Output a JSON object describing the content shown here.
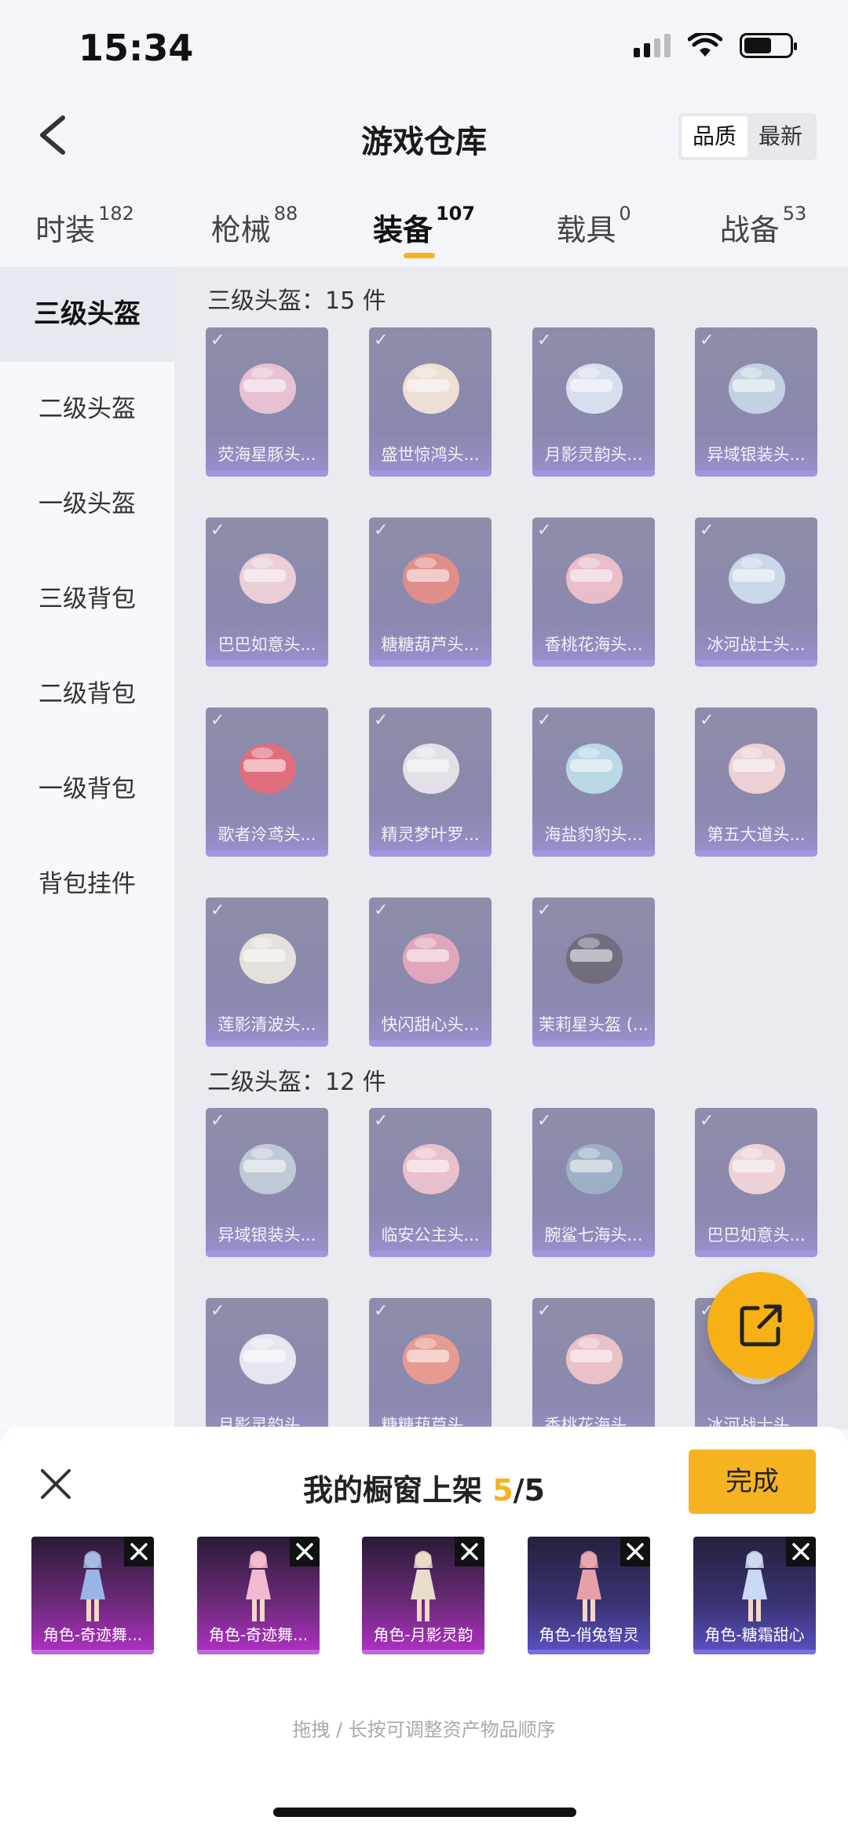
{
  "status": {
    "time": "15:34"
  },
  "header": {
    "title": "游戏仓库",
    "sort_options": [
      "品质",
      "最新"
    ]
  },
  "tabs": [
    {
      "label": "时装",
      "count": "182"
    },
    {
      "label": "枪械",
      "count": "88"
    },
    {
      "label": "装备",
      "count": "107"
    },
    {
      "label": "载具",
      "count": "0"
    },
    {
      "label": "战备",
      "count": "53"
    }
  ],
  "sidebar": [
    "三级头盔",
    "二级头盔",
    "一级头盔",
    "三级背包",
    "二级背包",
    "一级背包",
    "背包挂件"
  ],
  "sections": [
    {
      "title": "三级头盔：15 件",
      "items": [
        "荧海星豚头...",
        "盛世惊鸿头...",
        "月影灵韵头...",
        "异域银装头...",
        "巴巴如意头...",
        "糖糖葫芦头...",
        "香桃花海头...",
        "冰河战士头...",
        "歌者泠鸢头...",
        "精灵梦叶罗...",
        "海盐豹豹头...",
        "第五大道头...",
        "莲影清波头...",
        "快闪甜心头...",
        "茉莉星头盔 (..."
      ]
    },
    {
      "title": "二级头盔：12 件",
      "items": [
        "异域银装头...",
        "临安公主头...",
        "腕鲨七海头...",
        "巴巴如意头...",
        "月影灵韵头...",
        "糖糖葫芦头...",
        "香桃花海头...",
        "冰河战士头..."
      ]
    }
  ],
  "panel": {
    "title_prefix": "我的橱窗上架 ",
    "count_current": "5",
    "count_total": "/5",
    "done_label": "完成",
    "hint": "拖拽 / 长按可调整资产物品顺序",
    "items": [
      "角色-奇迹舞...",
      "角色-奇迹舞...",
      "角色-月影灵韵",
      "角色-俏兔智灵",
      "角色-糖霜甜心"
    ]
  },
  "colors": {
    "accent": "#f5b320",
    "card": "#8e8da9",
    "card_bar": "#a396e0"
  }
}
